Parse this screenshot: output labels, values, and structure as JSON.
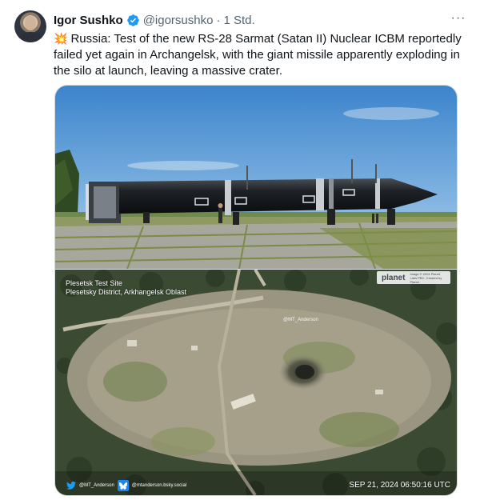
{
  "author": {
    "name": "Igor Sushko",
    "handle": "@igorsushko",
    "separator": "·",
    "time": "1 Std."
  },
  "more_label": "···",
  "tweet": {
    "emoji": "💥",
    "text": "Russia: Test of the new RS-28 Sarmat (Satan II) Nuclear ICBM reportedly failed yet again in Archangelsk, with the giant missile apparently exploding in the silo at launch, leaving a massive crater."
  },
  "media": {
    "satellite": {
      "title_line1": "Plesetsk Test Site",
      "title_line2": "Plesetsky District, Arkhangelsk Oblast",
      "planet_brand": "planet",
      "planet_fine": "Image © 2024 Planet Labs PBC. Created by Planet.",
      "watermark_center": "@MT_Anderson",
      "credit_twitter": "@MT_Anderson",
      "credit_bsky": "@mtanderson.bsky.social",
      "date_stamp": "SEP 21, 2024 06:50:16 UTC"
    }
  },
  "colors": {
    "verified": "#1d9bf0",
    "text_primary": "#0f1419",
    "text_secondary": "#536471",
    "border": "#cfd9de"
  },
  "icons": {
    "verified": "verified-badge-icon",
    "more": "more-icon",
    "twitter": "twitter-bird-icon",
    "bluesky": "bluesky-butterfly-icon"
  }
}
